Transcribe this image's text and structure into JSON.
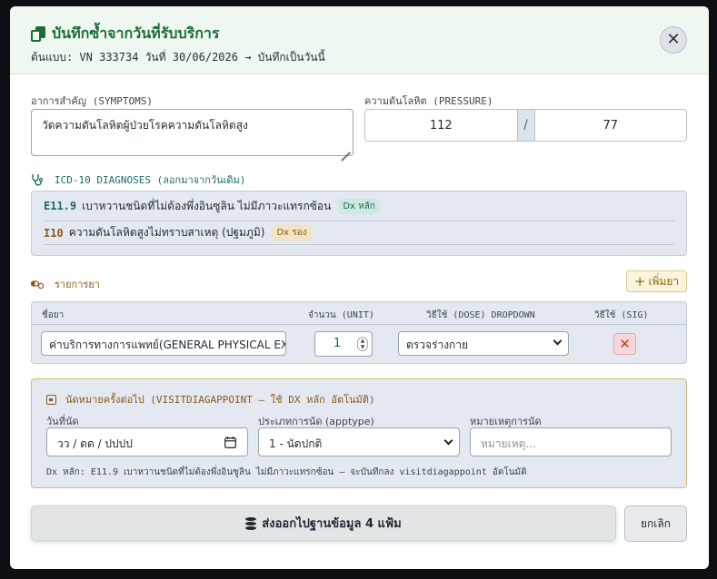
{
  "header": {
    "title": "บันทึกซ้ำจากวันที่รับบริการ",
    "subtitle": "ต้นแบบ: VN 333734 วันที่ 30/06/2026 → บันทึกเป็นวันนี้",
    "close_label": "✕"
  },
  "symptoms": {
    "label": "อาการสำคัญ (SYMPTOMS)",
    "value": "วัดความดันโลหิตผู้ป่วยโรคความดันโลหิตสูง"
  },
  "pressure": {
    "label": "ความดันโลหิต (PRESSURE)",
    "systolic": "112",
    "separator": "/",
    "diastolic": "77"
  },
  "diagnoses": {
    "title": "ICD-10 DIAGNOSES (ลอกมาจากวันเดิม)",
    "items": [
      {
        "code": "E11.9",
        "name": "เบาหวานชนิดที่ไม่ต้องพึ่งอินซูลิน ไม่มีภาวะแทรกซ้อน",
        "tag": "Dx หลัก",
        "tag_bg": "#cfe9e3",
        "tag_color": "#1f6a5a",
        "code_color": "#1f6a6a"
      },
      {
        "code": "I10",
        "name": "ความดันโลหิตสูงไม่ทราบสาเหตุ (ปฐมภูมิ)",
        "tag": "Dx รอง",
        "tag_bg": "#f3e4c4",
        "tag_color": "#8a5a1e",
        "code_color": "#8a5a1e"
      }
    ]
  },
  "medications": {
    "title": "รายการยา",
    "add_label": "เพิ่มยา",
    "headers": {
      "name": "ชื่อยา",
      "unit": "จำนวน (UNIT)",
      "dose": "วิธีใช้ (DOSE) DROPDOWN",
      "sig": "วิธีใช้ (SIG)"
    },
    "rows": [
      {
        "name": "ค่าบริการทางการแพทย์(GENERAL PHYSICAL EXA",
        "qty": "1",
        "dose": "ตรวจร่างกาย"
      }
    ]
  },
  "appointment": {
    "title": "นัดหมายครั้งต่อไป (VISITDIAGAPPOINT — ใช้ DX หลัก อัตโนมัติ)",
    "date_label": "วันที่นัด",
    "date_placeholder": "วว / ดด / ปปปป",
    "type_label": "ประเภทการนัด (apptype)",
    "type_value": "1 - นัดปกติ",
    "note_label": "หมายเหตุการนัด",
    "note_placeholder": "หมายเหตุ...",
    "footnote": "Dx หลัก: E11.9 เบาหวานชนิดที่ไม่ต้องพึ่งอินซูลิน ไม่มีภาวะแทรกซ้อน — จะบันทึกลง visitdiagappoint อัตโนมัติ"
  },
  "actions": {
    "submit_label": "ส่งออกไปฐานข้อมูล 4 แฟ้ม",
    "cancel_label": "ยกเลิก"
  },
  "colors": {
    "accent_green": "#1d6b36",
    "teal": "#1f6a6a",
    "amber": "#8a5a1e",
    "danger": "#c0392b"
  }
}
